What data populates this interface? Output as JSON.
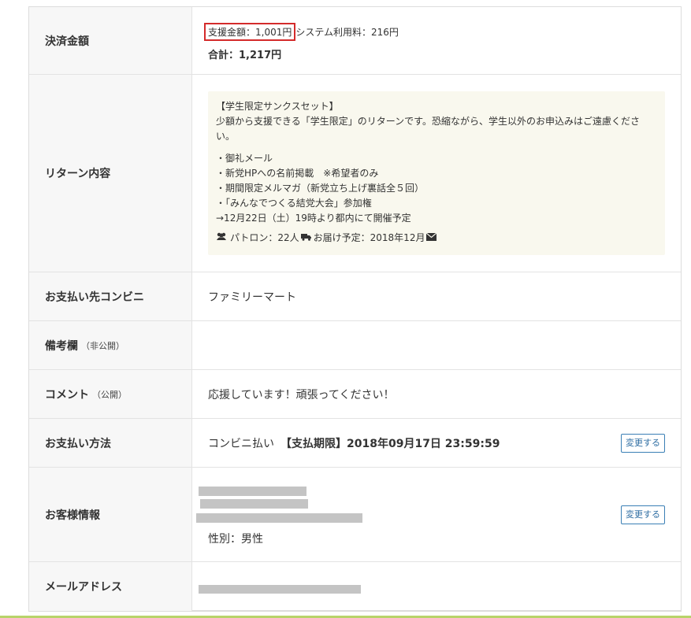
{
  "payment_amount": {
    "label": "決済金額",
    "support_amount": "支援金額：1,001円",
    "system_fee": "システム利用料：216円",
    "total": "合計：1,217円"
  },
  "return_content": {
    "label": "リターン内容",
    "title": "【学生限定サンクスセット】",
    "description": "少額から支援できる「学生限定」のリターンです。恐縮ながら、学生以外のお申込みはご遠慮ください。",
    "items": [
      "・御礼メール",
      "・新党HPへの名前掲載　※希望者のみ",
      "・期間限定メルマガ（新党立ち上げ裏話全５回）",
      "・「みんなでつくる結党大会」参加権",
      "→12月22日（土）19時より都内にて開催予定"
    ],
    "patrons": "パトロン：22人",
    "delivery": "お届け予定：2018年12月"
  },
  "store": {
    "label": "お支払い先コンビニ",
    "value": "ファミリーマート"
  },
  "memo": {
    "label": "備考欄",
    "sub": "（非公開）",
    "value": ""
  },
  "comment": {
    "label": "コメント",
    "sub": "（公開）",
    "value": "応援しています！頑張ってください！"
  },
  "payment_method": {
    "label": "お支払い方法",
    "method": "コンビニ払い",
    "deadline": "【支払期限】2018年09月17日 23:59:59",
    "change_button": "変更する"
  },
  "customer": {
    "label": "お客様情報",
    "gender": "性別：男性",
    "change_button": "変更する"
  },
  "email": {
    "label": "メールアドレス"
  },
  "colors": {
    "highlight_border": "#d42b2b",
    "button_border": "#3a7fb5",
    "return_box_bg": "#f9f8ee",
    "header_bg": "#f7f7f7"
  }
}
